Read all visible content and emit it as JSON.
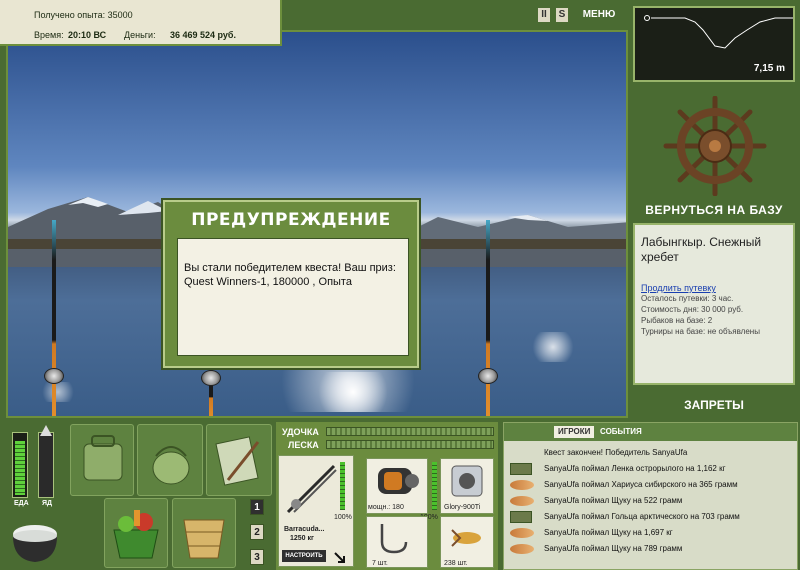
{
  "info": {
    "exp_label": "Получено опыта:",
    "exp_value": "35000",
    "time_label": "Время:",
    "time_value": "20:10 ВС",
    "money_label": "Деньги:",
    "money_value": "36 469 524 руб."
  },
  "top_buttons": {
    "pause": "II",
    "s": "S",
    "menu": "МЕНЮ"
  },
  "depth": {
    "value": "7,15 m"
  },
  "right_panel": {
    "return_base": "ВЕРНУТЬСЯ НА БАЗУ",
    "location_title": "Лабынгкыр. Снежный хребет",
    "extend_link": "Продлить путевку",
    "lines": [
      "Осталось путевки: 3 час.",
      "Стоимость дня: 30 000 руб.",
      "Рыбаков на базе: 2",
      "Турниры на базе: не объявлены"
    ],
    "bans": "ЗАПРЕТЫ"
  },
  "dialog": {
    "title": "ПРЕДУПРЕЖДЕНИЕ",
    "message": "Вы стали победителем квеста! Ваш приз: Quest Winners-1, 180000 , Опыта"
  },
  "gauges": {
    "food_label": "ЕДА",
    "food_level": 0.85,
    "yd_label": "ЯД",
    "yd_level": 0.0
  },
  "slot_numbers": [
    "1",
    "2",
    "3"
  ],
  "rod_panel": {
    "rod_label": "УДОЧКА",
    "line_label": "ЛЕСКА",
    "rod_name": "Barracuda...",
    "rod_weight": "1250 кг",
    "rod_pct": "100%",
    "reel_label": "мощн.: 180",
    "reel_pct": "100%",
    "line_name": "Glory-900Ti",
    "hook_count": "7 шт.",
    "lure_count": "238 шт.",
    "setup_button": "НАСТРОИТЬ"
  },
  "chat": {
    "tab_players": "ИГРОКИ",
    "tab_events": "СОБЫТИЯ",
    "messages": [
      {
        "icon": "none",
        "text": "Квест закончен! Победитель SanyaUfa"
      },
      {
        "icon": "map",
        "text": "SanyaUfa поймал Ленка острорылого на 1,162 кг"
      },
      {
        "icon": "fish",
        "text": "SanyaUfa поймал Хариуса сибирского на 365 грамм"
      },
      {
        "icon": "fish",
        "text": "SanyaUfa поймал Щуку на 522 грамм"
      },
      {
        "icon": "map",
        "text": "SanyaUfa поймал Гольца арктического на 703 грамм"
      },
      {
        "icon": "fish",
        "text": "SanyaUfa поймал Щуку на 1,697 кг"
      },
      {
        "icon": "fish",
        "text": "SanyaUfa поймал Щуку на 789 грамм"
      }
    ]
  },
  "colors": {
    "panel_green": "#4a6b32",
    "link_blue": "#1a3fb0",
    "gauge_green": "#5fd13c"
  }
}
